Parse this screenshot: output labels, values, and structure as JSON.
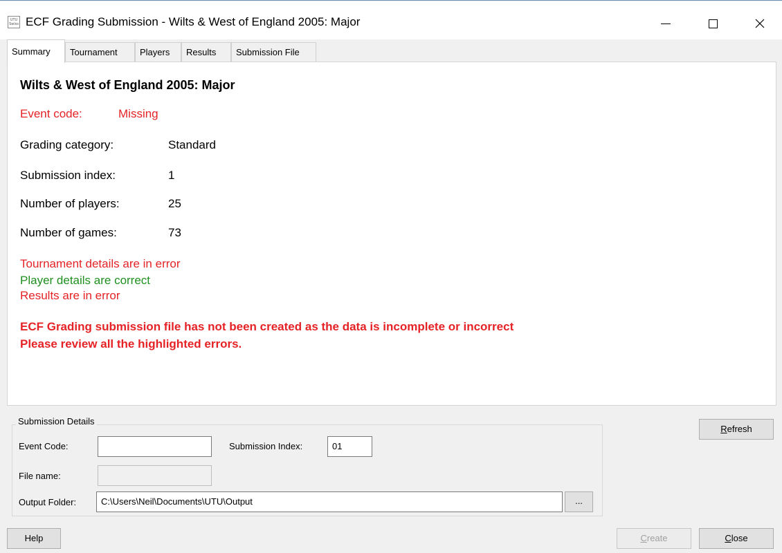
{
  "window": {
    "app_icon_text": "UTU Swiss",
    "title": "ECF Grading Submission - Wilts & West of England 2005: Major"
  },
  "tabs": [
    {
      "label": "Summary"
    },
    {
      "label": "Tournament"
    },
    {
      "label": "Players"
    },
    {
      "label": "Results"
    },
    {
      "label": "Submission File"
    }
  ],
  "summary": {
    "heading": "Wilts & West of England 2005: Major",
    "event_code_label": "Event code:",
    "event_code_value": "Missing",
    "grading_category_label": "Grading category:",
    "grading_category_value": "Standard",
    "submission_index_label": "Submission index:",
    "submission_index_value": "1",
    "players_label": "Number of players:",
    "players_value": "25",
    "games_label": "Number of games:",
    "games_value": "73",
    "status": {
      "tournament": "Tournament details are in error",
      "players": "Player details are correct",
      "results": "Results are in error"
    },
    "error_line1": "ECF Grading submission file has not been created as the data is incomplete or incorrect",
    "error_line2": "Please review all the highlighted errors."
  },
  "submission_details": {
    "group_title": "Submission Details",
    "event_code_label": "Event Code:",
    "event_code_value": "",
    "submission_index_label": "Submission Index:",
    "submission_index_value": "01",
    "file_name_label": "File name:",
    "file_name_value": "",
    "output_folder_label": "Output Folder:",
    "output_folder_value": "C:\\Users\\Neil\\Documents\\UTU\\Output",
    "browse_label": "..."
  },
  "buttons": {
    "refresh_first": "R",
    "refresh_rest": "efresh",
    "help": "Help",
    "create_first": "C",
    "create_rest": "reate",
    "close_first": "C",
    "close_rest": "lose"
  },
  "colors": {
    "error": "#e52226",
    "ok": "#1f8f1f"
  }
}
